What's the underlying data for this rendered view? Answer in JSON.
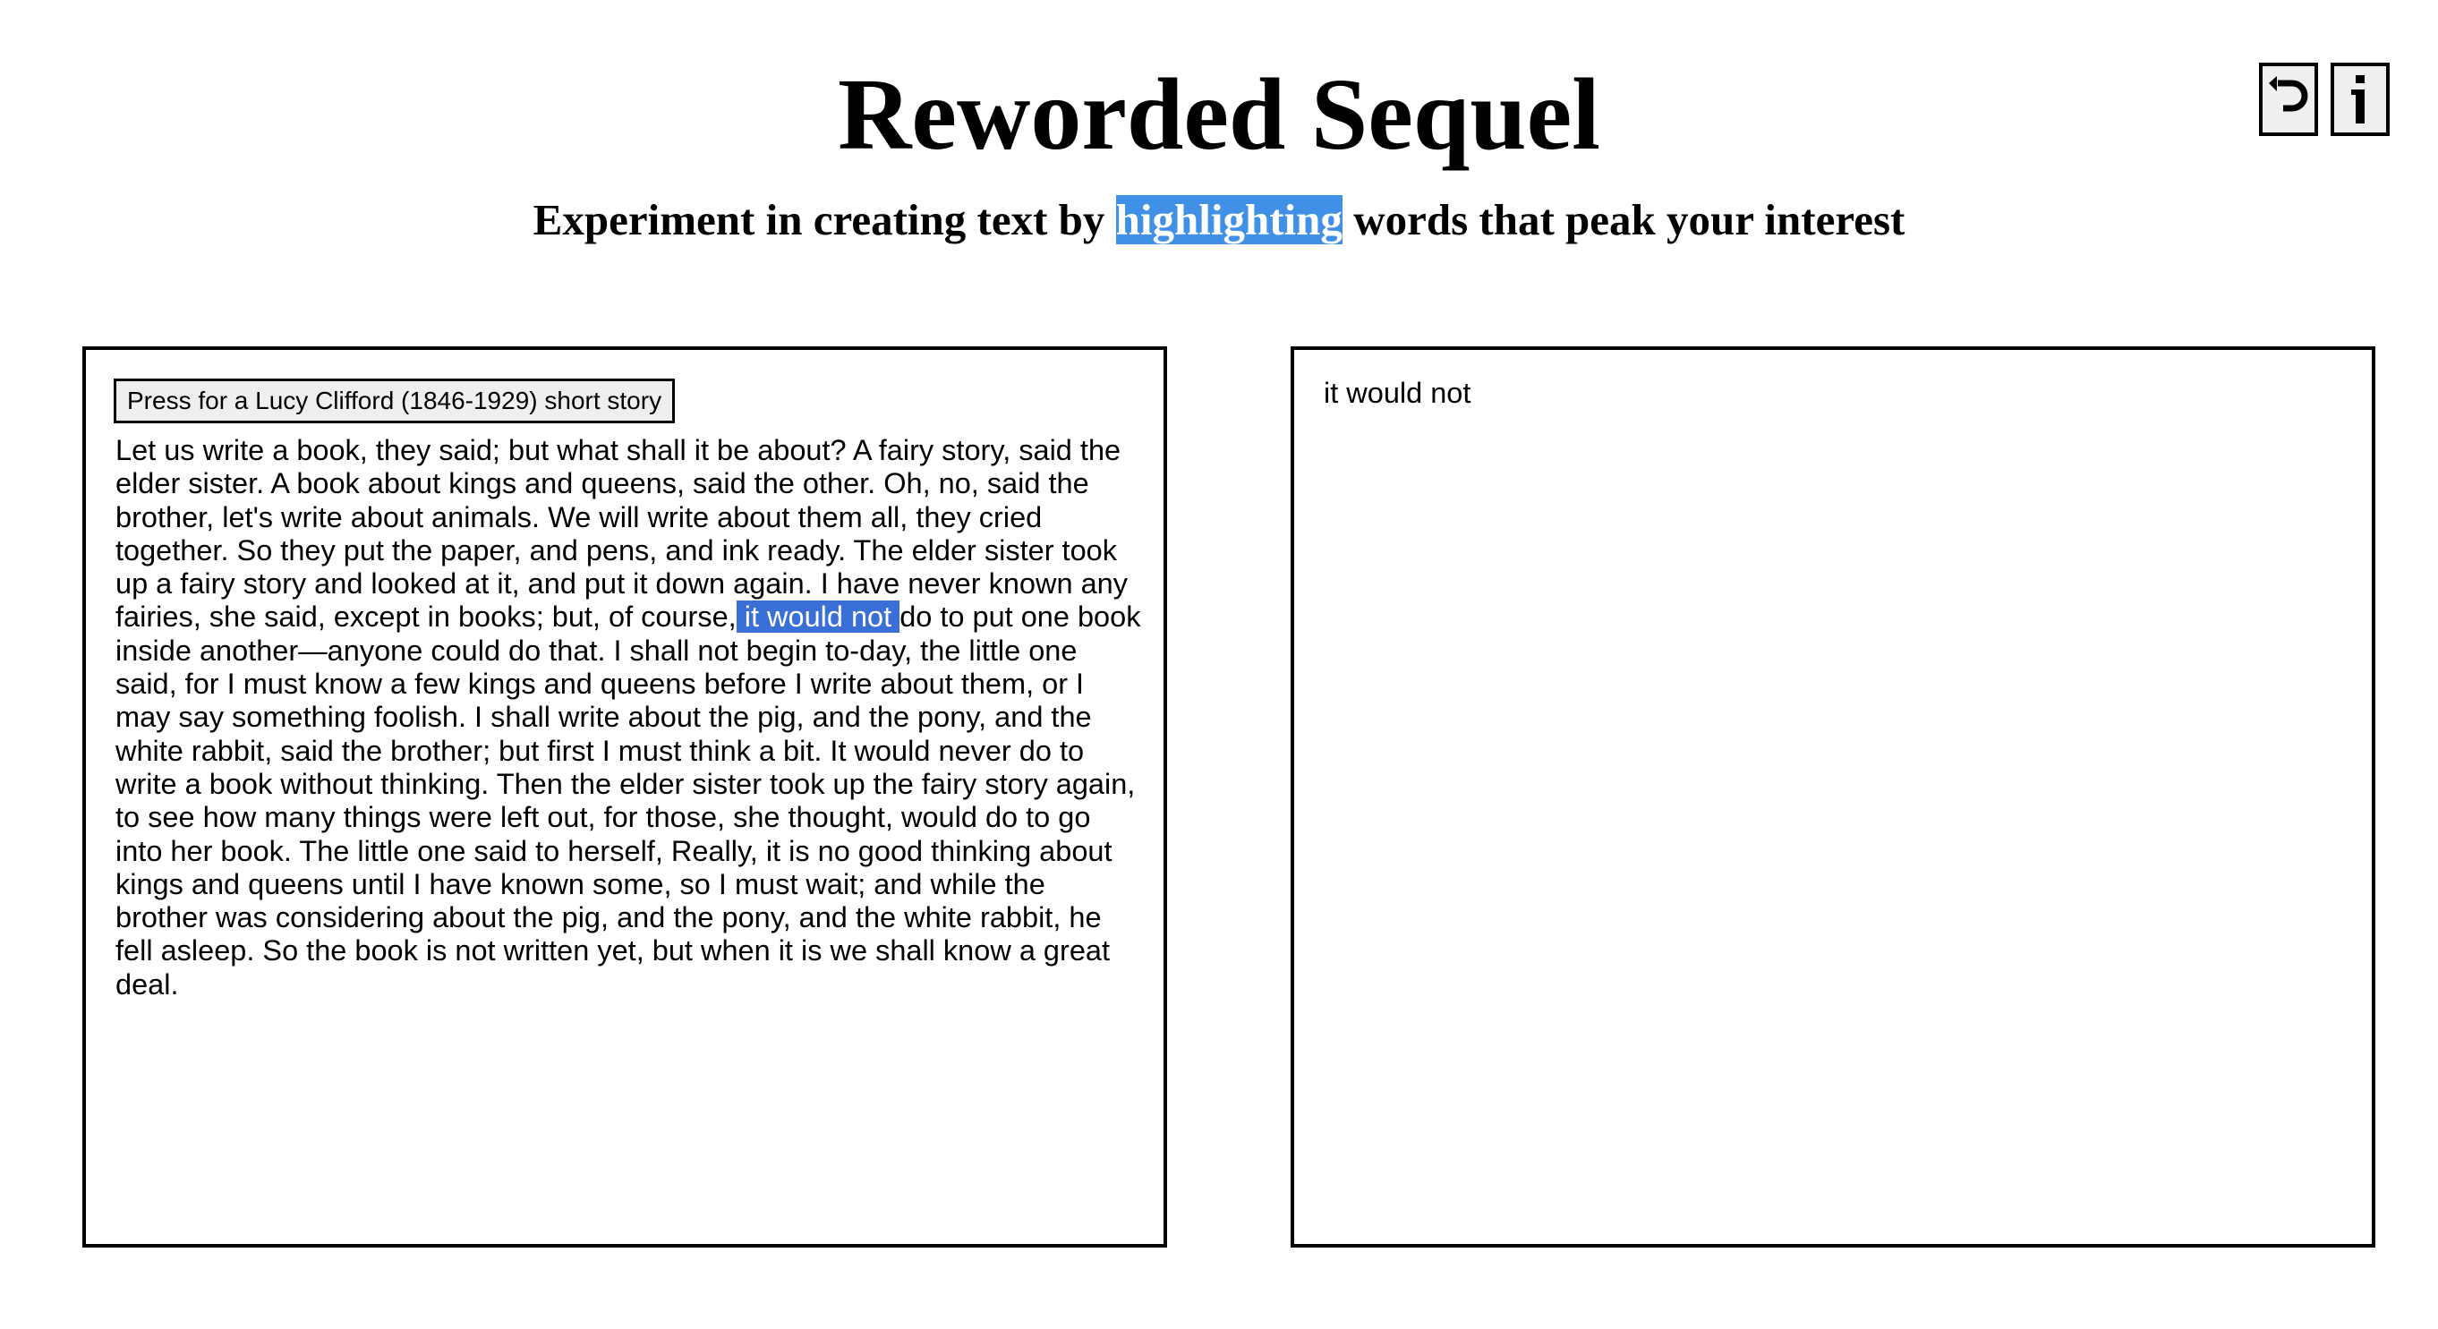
{
  "header": {
    "title": "Reworded Sequel",
    "subtitle_before": "Experiment in creating text by ",
    "subtitle_highlight": "highlighting",
    "subtitle_after": " words that peak your interest",
    "highlight_color": "#3f90e6"
  },
  "toolbar": {
    "undo_icon": "undo-icon",
    "info_icon": "info-icon"
  },
  "source_panel": {
    "story_button_label": "Press for a Lucy Clifford (1846-1929) short story",
    "text_before_selection": "Let us write a book, they said; but what shall it be about? A fairy story, said the elder sister. A book about kings and queens, said the other. Oh, no, said the brother, let's write about animals. We will write about them all, they cried together. So they put the paper, and pens, and ink ready. The elder sister took up a fairy story and looked at it, and put it down again. I have never known any fairies, she said, except in books; but, of course,",
    "selected_text": " it would not ",
    "text_after_selection": "do to put one book inside another—anyone could do that. I shall not begin to-day, the little one said, for I must know a few kings and queens before I write about them, or I may say something foolish. I shall write about the pig, and the pony, and the white rabbit, said the brother; but first I must think a bit. It would never do to write a book without thinking. Then the elder sister took up the fairy story again, to see how many things were left out, for those, she thought, would do to go into her book. The little one said to herself, Really, it is no good thinking about kings and queens until I have known some, so I must wait; and while the brother was considering about the pig, and the pony, and the white rabbit, he fell asleep. So the book is not written yet, but when it is we shall know a great deal.",
    "selection_color": "#3a6fd8"
  },
  "output_panel": {
    "text": "it would not"
  }
}
